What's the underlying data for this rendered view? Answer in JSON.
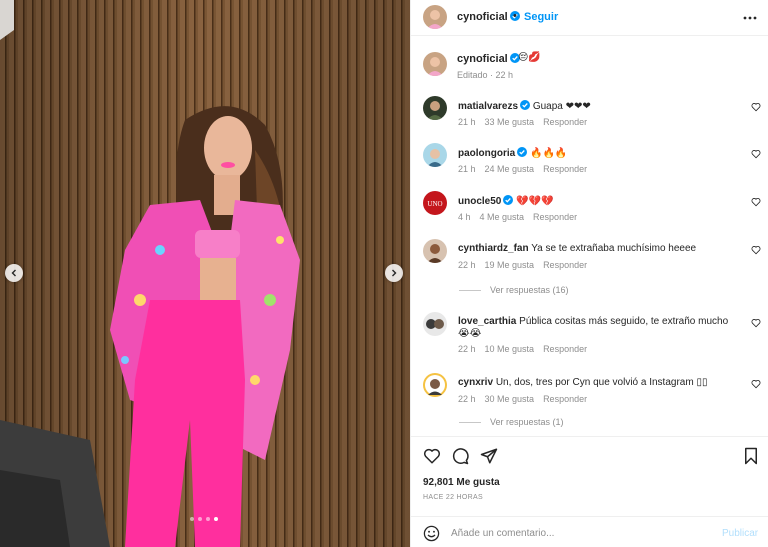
{
  "theme": {
    "accent": "#0095f6",
    "heart_red": "#ed4956",
    "muted": "#8e8e8e"
  },
  "post": {
    "username": "cynoficial",
    "follow_label": "Seguir",
    "separator": "•",
    "caption_emoji": "😔💋",
    "caption_meta": "Editado · 22 h",
    "carousel": {
      "dots": 4,
      "active_index": 3
    }
  },
  "comments": [
    {
      "user": "matialvarezs",
      "verified": true,
      "text": "Guapa ❤❤❤",
      "time": "21 h",
      "likes": "33 Me gusta",
      "reply": "Responder"
    },
    {
      "user": "paolongoria",
      "verified": true,
      "text": "🔥🔥🔥",
      "time": "21 h",
      "likes": "24 Me gusta",
      "reply": "Responder"
    },
    {
      "user": "unocle50",
      "verified": true,
      "text": "💔💔💔",
      "time": "4 h",
      "likes": "4 Me gusta",
      "reply": "Responder"
    },
    {
      "user": "cynthiardz_fan",
      "verified": false,
      "text": "Ya se te extrañaba muchísimo heeee",
      "time": "22 h",
      "likes": "19 Me gusta",
      "reply": "Responder",
      "view_replies": "Ver respuestas (16)"
    },
    {
      "user": "love_carthia",
      "verified": false,
      "text": "Pública cositas más seguido, te extraño mucho",
      "text2": "😭😭",
      "time": "22 h",
      "likes": "10 Me gusta",
      "reply": "Responder"
    },
    {
      "user": "cynxriv",
      "verified": false,
      "text": "Un, dos, tres por Cyn que volvió a Instagram ▯▯",
      "time": "22 h",
      "likes": "30 Me gusta",
      "reply": "Responder",
      "view_replies": "Ver respuestas (1)"
    }
  ],
  "footer": {
    "likes": "92,801 Me gusta",
    "time_ago": "HACE 22 HORAS",
    "comment_placeholder": "Añade un comentario...",
    "publish_label": "Publicar"
  },
  "icons": [
    "chevron-left-icon",
    "chevron-right-icon",
    "more-icon",
    "verified-icon",
    "heart-icon",
    "comment-icon",
    "share-icon",
    "bookmark-icon",
    "emoji-icon"
  ]
}
